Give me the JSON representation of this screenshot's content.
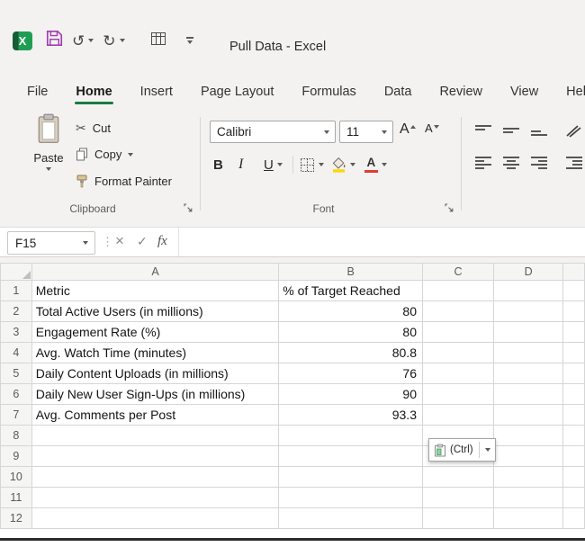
{
  "title_bar": {
    "app_title": "Pull Data  -  Excel"
  },
  "icons": {
    "logo_letter": "X",
    "undo_glyph": "↺",
    "redo_glyph": "↻",
    "cut_glyph": "✂",
    "separator_dots": "⋮"
  },
  "menu_tabs": [
    {
      "label": "File",
      "active": false
    },
    {
      "label": "Home",
      "active": true
    },
    {
      "label": "Insert",
      "active": false
    },
    {
      "label": "Page Layout",
      "active": false
    },
    {
      "label": "Formulas",
      "active": false
    },
    {
      "label": "Data",
      "active": false
    },
    {
      "label": "Review",
      "active": false
    },
    {
      "label": "View",
      "active": false
    },
    {
      "label": "Help",
      "active": false
    }
  ],
  "ribbon": {
    "clipboard": {
      "paste_label": "Paste",
      "cut_label": "Cut",
      "copy_label": "Copy",
      "format_painter_label": "Format Painter",
      "group_label": "Clipboard"
    },
    "font": {
      "font_name": "Calibri",
      "font_size": "11",
      "increase_font_label": "A",
      "decrease_font_label": "A",
      "bold_label": "B",
      "italic_label": "I",
      "underline_label": "U",
      "font_color_label": "A",
      "group_label": "Font"
    }
  },
  "formula_bar": {
    "name_box_value": "F15",
    "cancel_glyph": "×",
    "enter_glyph": "✓",
    "fx_label": "fx",
    "formula_value": ""
  },
  "sheet": {
    "column_headers": [
      "A",
      "B",
      "C",
      "D",
      ""
    ],
    "row_count": 12,
    "cells": [
      {
        "row": 1,
        "A": "Metric",
        "B": "% of Target Reached"
      },
      {
        "row": 2,
        "A": "Total Active Users (in millions)",
        "B": "80"
      },
      {
        "row": 3,
        "A": "Engagement Rate (%)",
        "B": "80"
      },
      {
        "row": 4,
        "A": "Avg. Watch Time (minutes)",
        "B": "80.8"
      },
      {
        "row": 5,
        "A": "Daily Content Uploads (in millions)",
        "B": "76"
      },
      {
        "row": 6,
        "A": "Daily New User Sign-Ups (in millions)",
        "B": "90"
      },
      {
        "row": 7,
        "A": "Avg. Comments per Post",
        "B": "93.3"
      }
    ]
  },
  "paste_options": {
    "label": "(Ctrl)"
  },
  "colors": {
    "excel_green": "#107c41",
    "tab_underline": "#1a7a44",
    "save_icon_purple": "#a23db2",
    "fill_yellow": "#ffd800",
    "font_color_red": "#e03c31"
  }
}
